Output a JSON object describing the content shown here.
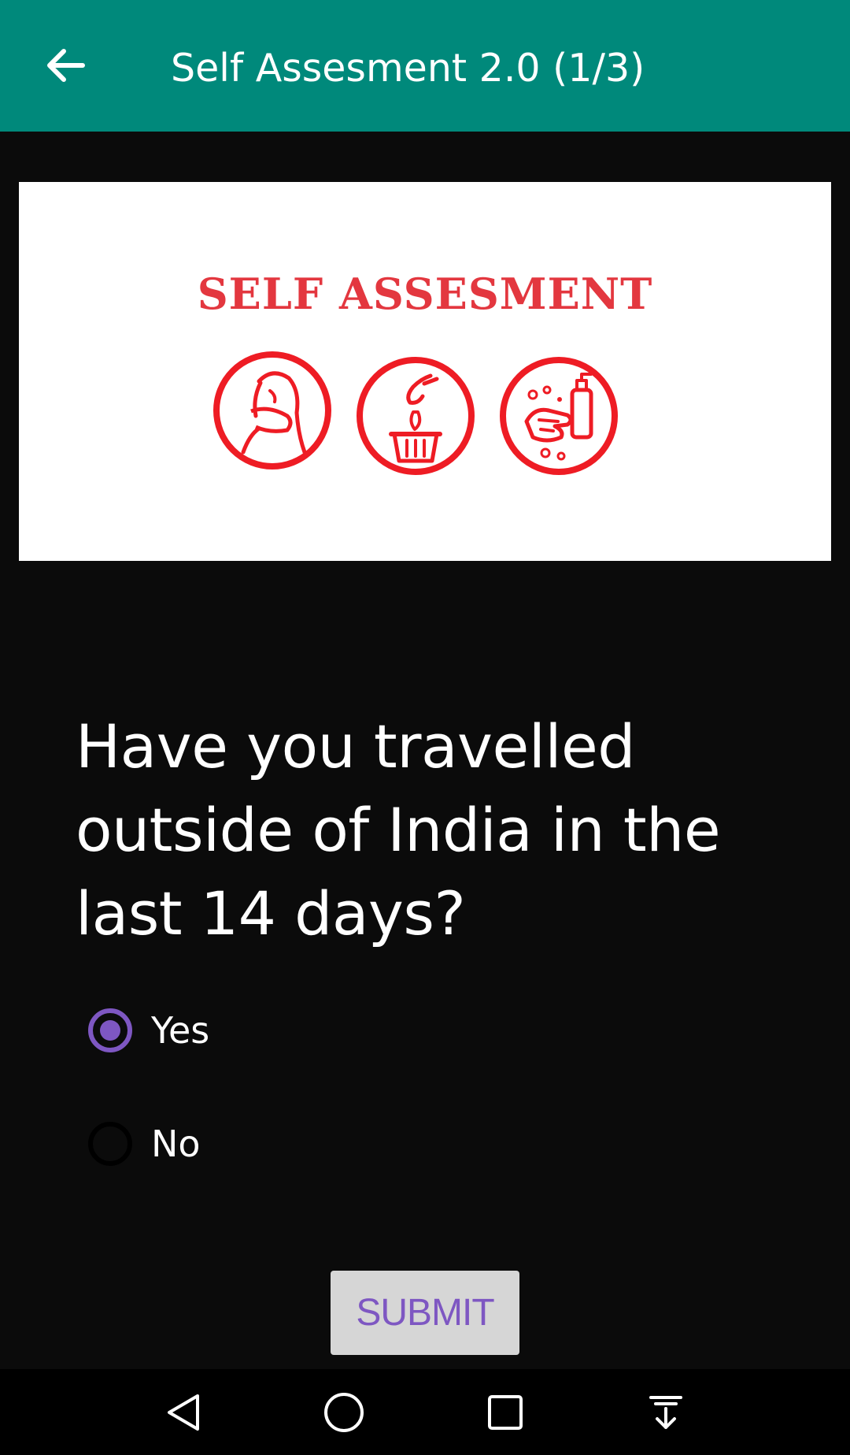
{
  "app_bar": {
    "back_icon": "arrow-back-icon",
    "title": "Self Assesment 2.0 (1/3)",
    "background": "#00897b"
  },
  "banner": {
    "heading": "SELF ASSESMENT",
    "heading_color": "#e3373f",
    "icons": [
      "cough-into-elbow-icon",
      "dispose-tissue-icon",
      "wash-hands-icon"
    ]
  },
  "question": {
    "text": "Have you travelled outside of India in the last 14 days?"
  },
  "options": [
    {
      "label": "Yes",
      "selected": true
    },
    {
      "label": "No",
      "selected": false
    }
  ],
  "submit": {
    "label": "SUBMIT",
    "color": "#7e57c2"
  },
  "nav_bar": {
    "icons": [
      "back-triangle-icon",
      "home-circle-icon",
      "recents-square-icon",
      "notification-pull-down-icon"
    ]
  }
}
